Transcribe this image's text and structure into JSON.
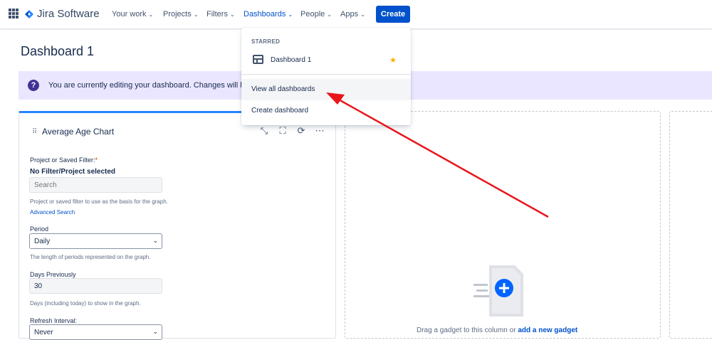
{
  "header": {
    "product": "Jira Software",
    "nav": [
      {
        "label": "Your work"
      },
      {
        "label": "Projects"
      },
      {
        "label": "Filters"
      },
      {
        "label": "Dashboards"
      },
      {
        "label": "People"
      },
      {
        "label": "Apps"
      }
    ],
    "create_label": "Create"
  },
  "page": {
    "title": "Dashboard 1"
  },
  "banner": {
    "message": "You are currently editing your dashboard. Changes will be s"
  },
  "gadget": {
    "title": "Average Age Chart",
    "filter_label": "Project or Saved Filter:",
    "required_mark": "*",
    "filter_selected": "No Filter/Project selected",
    "search_placeholder": "Search",
    "filter_hint": "Project or saved filter to use as the basis for the graph.",
    "advanced_search": "Advanced Search",
    "period_label": "Period",
    "period_value": "Daily",
    "period_hint": "The length of periods represented on the graph.",
    "days_label": "Days Previously",
    "days_value": "30",
    "days_hint": "Days (including today) to show in the graph.",
    "refresh_label": "Refresh Interval:",
    "refresh_value": "Never"
  },
  "dropzone": {
    "text": "Drag a gadget to this column or ",
    "link": "add a new gadget"
  },
  "dropdown": {
    "section": "STARRED",
    "starred_item": "Dashboard 1",
    "view_all": "View all dashboards",
    "create": "Create dashboard"
  },
  "colors": {
    "primary": "#0052cc",
    "banner_bg": "#eae6ff",
    "star": "#ffab00",
    "annotation_arrow": "#e8151b"
  }
}
